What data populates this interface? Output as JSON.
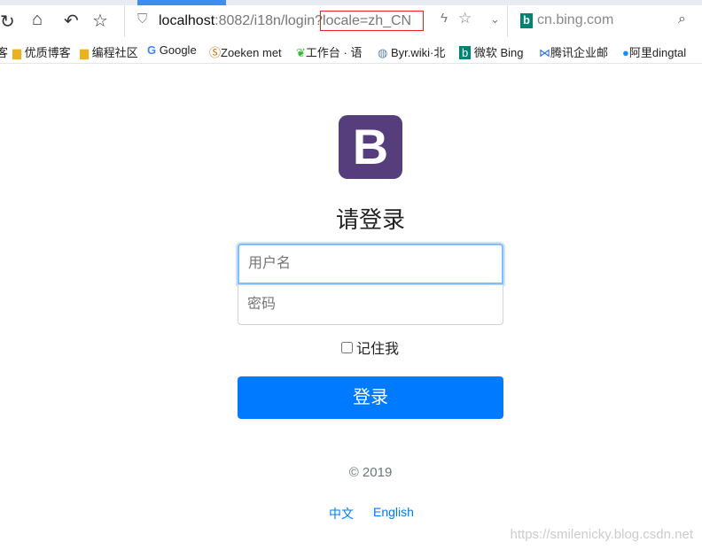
{
  "browser": {
    "url_host": "localhost",
    "url_rest": ":8082/i18n/login",
    "url_query": "?locale=zh_CN",
    "search_engine": "cn.bing.com"
  },
  "bookmarks": [
    "客",
    "优质博客",
    "编程社区",
    "Google",
    "Zoeken met",
    "工作台 · 语",
    "Byr.wiki·北",
    "微软 Bing",
    "腾讯企业邮",
    "阿里dingtal"
  ],
  "page": {
    "logo": "B",
    "title": "请登录",
    "username_placeholder": "用户名",
    "password_placeholder": "密码",
    "remember": "记住我",
    "submit": "登录",
    "copyright": "© 2019",
    "lang_zh": "中文",
    "lang_en": "English",
    "watermark": "https://smilenicky.blog.csdn.net"
  }
}
